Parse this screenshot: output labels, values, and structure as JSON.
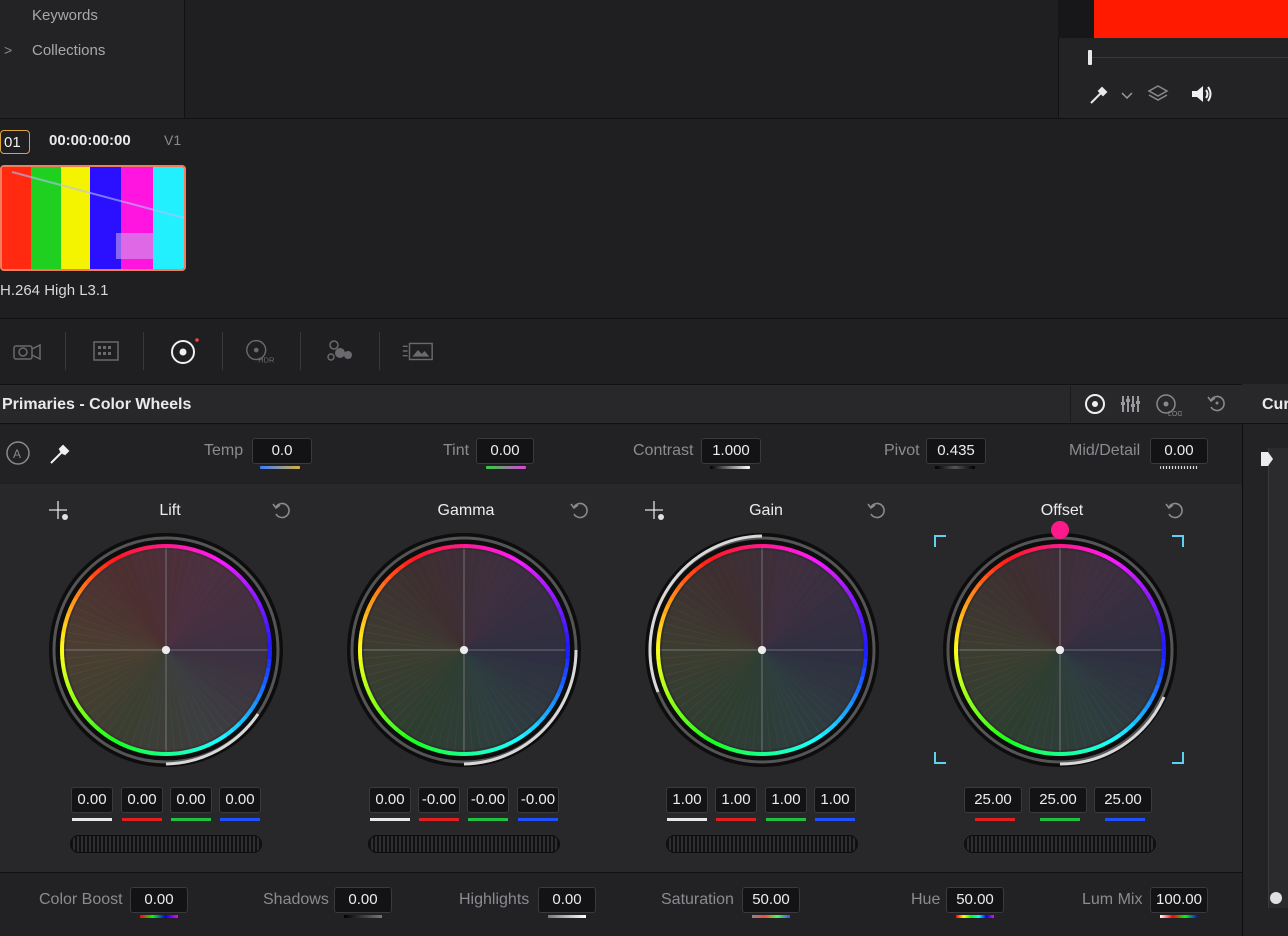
{
  "sidebar": {
    "items": [
      {
        "label": "Keywords"
      },
      {
        "label": "Collections",
        "chevron": ">"
      }
    ]
  },
  "clip": {
    "number": "01",
    "timecode": "00:00:00:00",
    "track": "V1",
    "codec": "H.264 High L3.1",
    "bars": [
      "#ff2a10",
      "#20d020",
      "#f4f400",
      "#2a10ff",
      "#ff14e0",
      "#22f0ff"
    ]
  },
  "viewer": {
    "icons": [
      "picker-icon",
      "chevron-down-icon",
      "layers-icon",
      "speaker-icon"
    ]
  },
  "palette_icons": [
    "camera-raw-icon",
    "color-match-icon",
    "color-wheels-icon",
    "hdr-icon",
    "rgb-mixer-icon",
    "motion-effects-icon"
  ],
  "panel": {
    "title": "Primaries - Color Wheels",
    "right_title": "Curves",
    "right_title_visible": "Cur"
  },
  "adjust": {
    "temp": {
      "label": "Temp",
      "value": "0.0"
    },
    "tint": {
      "label": "Tint",
      "value": "0.00"
    },
    "contrast": {
      "label": "Contrast",
      "value": "1.000"
    },
    "pivot": {
      "label": "Pivot",
      "value": "0.435"
    },
    "mid_detail": {
      "label": "Mid/Detail",
      "value": "0.00"
    }
  },
  "wheels": [
    {
      "title": "Lift",
      "values": [
        "0.00",
        "0.00",
        "0.00",
        "0.00"
      ]
    },
    {
      "title": "Gamma",
      "values": [
        "0.00",
        "-0.00",
        "-0.00",
        "-0.00"
      ]
    },
    {
      "title": "Gain",
      "values": [
        "1.00",
        "1.00",
        "1.00",
        "1.00"
      ]
    },
    {
      "title": "Offset",
      "values": [
        "25.00",
        "25.00",
        "25.00"
      ]
    }
  ],
  "bottom": {
    "color_boost": {
      "label": "Color Boost",
      "value": "0.00"
    },
    "shadows": {
      "label": "Shadows",
      "value": "0.00"
    },
    "highlights": {
      "label": "Highlights",
      "value": "0.00"
    },
    "saturation": {
      "label": "Saturation",
      "value": "50.00"
    },
    "hue": {
      "label": "Hue",
      "value": "50.00"
    },
    "lum_mix": {
      "label": "Lum Mix",
      "value": "100.00"
    }
  },
  "colors": {
    "accent_offset": "#ff1a8c",
    "badge_border": "#d9a63a",
    "clip_border": "#f07e5a",
    "bracket": "#5fd0f0"
  }
}
